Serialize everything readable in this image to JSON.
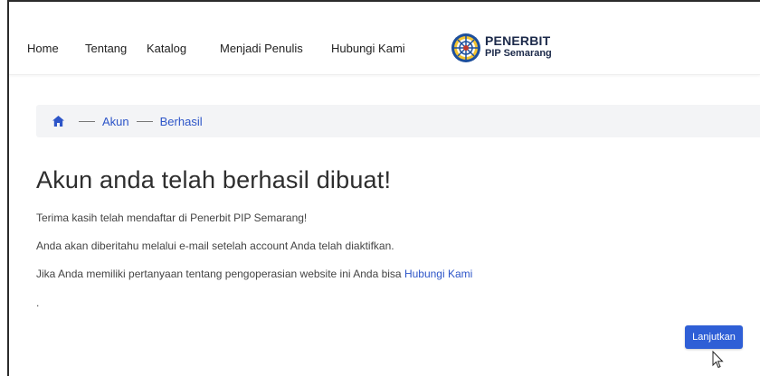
{
  "nav": {
    "items": [
      {
        "label": "Home"
      },
      {
        "label": "Tentang"
      },
      {
        "label": "Katalog"
      },
      {
        "label": "Menjadi Penulis"
      },
      {
        "label": "Hubungi Kami"
      }
    ],
    "brand_line1": "PENERBIT",
    "brand_line2": "PIP Semarang"
  },
  "breadcrumb": {
    "items": [
      {
        "label": "Akun"
      },
      {
        "label": "Berhasil"
      }
    ]
  },
  "main": {
    "title": "Akun anda telah berhasil dibuat!",
    "para1": "Terima kasih telah mendaftar di Penerbit PIP Semarang!",
    "para2": "Anda akan diberitahu melalui e-mail setelah account Anda telah diaktifkan.",
    "para3_text": "Jika Anda memiliki pertanyaan tentang pengoperasian website ini Anda bisa ",
    "para3_link": "Hubungi Kami",
    "dot": ".",
    "continue_label": "Lanjutkan"
  },
  "colors": {
    "accent": "#2f5fd6",
    "link": "#2d55c8",
    "breadcrumb_bg": "#f3f4f6"
  },
  "icons": [
    "home-icon",
    "brand-logo",
    "mouse-cursor-icon"
  ]
}
